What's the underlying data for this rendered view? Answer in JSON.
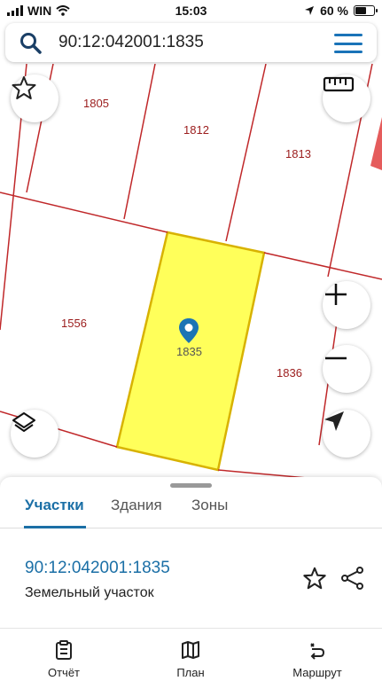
{
  "status_bar": {
    "carrier": "WIN",
    "time": "15:03",
    "battery": "60 %",
    "battery_level": 0.6
  },
  "search": {
    "value": "90:12:042001:1835",
    "icon": "search-icon",
    "menu_icon": "menu-icon"
  },
  "map": {
    "plots": [
      "1805",
      "1812",
      "1813",
      "1556",
      "1835",
      "1836"
    ],
    "colors": {
      "boundary": "#c0282a",
      "selected_fill": "#ffff5a",
      "selected_border": "#d8b200",
      "marker": "#1b74b4"
    },
    "buttons": [
      "favorite-star-icon",
      "ruler-icon",
      "zoom-in-icon",
      "zoom-out-icon",
      "layers-icon",
      "locate-arrow-icon"
    ]
  },
  "sheet": {
    "tabs": [
      "Участки",
      "Здания",
      "Зоны"
    ],
    "active_tab": "Участки",
    "parcel_id": "90:12:042001:1835",
    "parcel_type": "Земельный участок"
  },
  "nav": {
    "items": [
      {
        "label": "Отчёт",
        "icon": "report-icon"
      },
      {
        "label": "План",
        "icon": "map-plan-icon"
      },
      {
        "label": "Маршрут",
        "icon": "route-icon"
      }
    ]
  },
  "accent_color": "#1b6fa6"
}
